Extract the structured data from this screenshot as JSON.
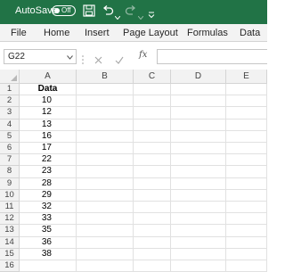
{
  "titlebar": {
    "autosave_label": "AutoSave",
    "autosave_state": "Off",
    "color": "#217346",
    "icons": [
      "save-icon",
      "undo-icon",
      "undo-dropdown-icon",
      "redo-icon",
      "redo-dropdown-icon",
      "customize-toolbar-icon"
    ]
  },
  "ribbon": {
    "tabs": [
      "File",
      "Home",
      "Insert",
      "Page Layout",
      "Formulas",
      "Data"
    ]
  },
  "formula_bar": {
    "name_box": "G22",
    "fx": "fx",
    "formula": ""
  },
  "sheet": {
    "columns": [
      "A",
      "B",
      "C",
      "D",
      "E"
    ],
    "rows": [
      "1",
      "2",
      "3",
      "4",
      "5",
      "6",
      "7",
      "8",
      "9",
      "10",
      "11",
      "12",
      "13",
      "14",
      "15",
      "16"
    ],
    "column_a": [
      "Data",
      "10",
      "12",
      "13",
      "16",
      "17",
      "22",
      "23",
      "28",
      "29",
      "32",
      "33",
      "35",
      "36",
      "38",
      ""
    ]
  }
}
